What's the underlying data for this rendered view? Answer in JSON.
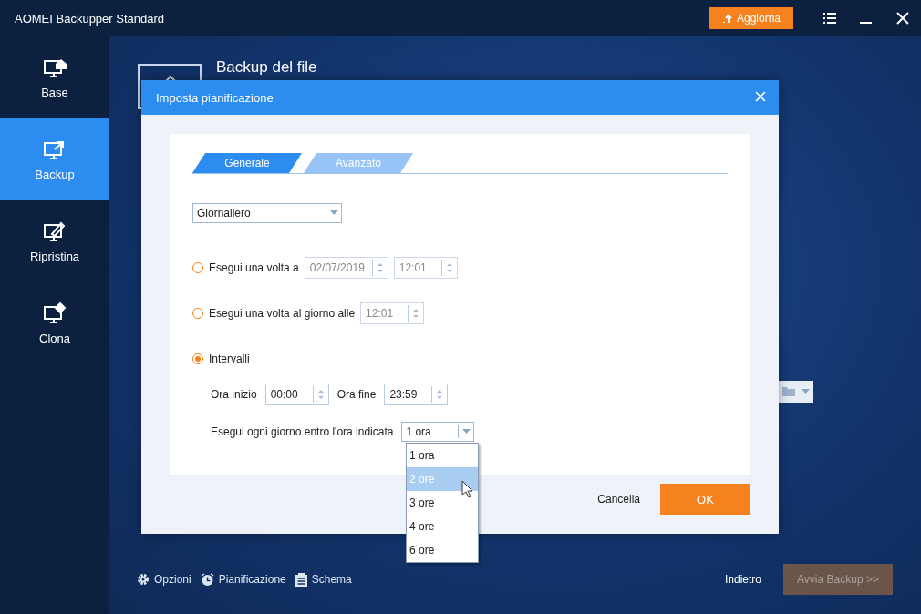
{
  "window": {
    "title": "AOMEI Backupper Standard",
    "upgrade_button": "Aggiorna"
  },
  "sidebar": {
    "items": [
      {
        "label": "Base",
        "kind": "home",
        "selected": false
      },
      {
        "label": "Backup",
        "kind": "backup",
        "selected": true
      },
      {
        "label": "Ripristina",
        "kind": "restore",
        "selected": false
      },
      {
        "label": "Clona",
        "kind": "clone",
        "selected": false
      }
    ]
  },
  "page": {
    "title": "Backup del file"
  },
  "dialog": {
    "title": "Imposta pianificazione",
    "tabs": [
      {
        "label": "Generale",
        "selected": true
      },
      {
        "label": "Avanzato",
        "selected": false
      }
    ],
    "frequency": "Giornaliero",
    "options": [
      {
        "kind": "once",
        "label": "Esegui una volta a",
        "selected": false,
        "date": "02/07/2019",
        "time": "12:01"
      },
      {
        "kind": "daily",
        "label": "Esegui una volta al giorno alle",
        "selected": false,
        "time": "12:01"
      },
      {
        "kind": "interval",
        "label": "Intervalli",
        "selected": true
      }
    ],
    "interval": {
      "start_label": "Ora inizio",
      "start": "00:00",
      "end_label": "Ora fine",
      "end": "23:59",
      "every_label": "Esegui ogni giorno entro l'ora indicata",
      "every": "1 ora",
      "dropdown": [
        {
          "label": "1 ora",
          "selected": false
        },
        {
          "label": "2 ore",
          "selected": true
        },
        {
          "label": "3 ore",
          "selected": false
        },
        {
          "label": "4 ore",
          "selected": false
        },
        {
          "label": "6 ore",
          "selected": false
        }
      ]
    },
    "cancel": "Cancella",
    "ok": "OK"
  },
  "footer": {
    "tools": [
      {
        "label": "Opzioni",
        "kind": "gear"
      },
      {
        "label": "Pianificazione",
        "kind": "clock"
      },
      {
        "label": "Schema",
        "kind": "list"
      }
    ],
    "back": "Indietro",
    "start": {
      "label": "Avvia Backup >>",
      "disabled": true
    }
  }
}
